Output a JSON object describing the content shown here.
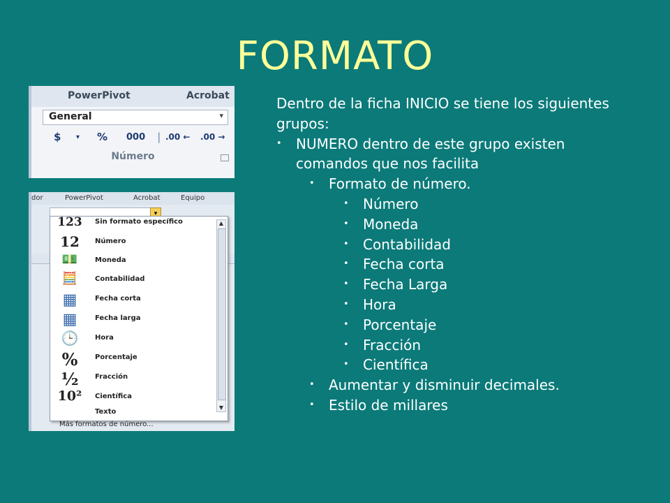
{
  "slide": {
    "title": "FORMATO",
    "intro": "Dentro de la ficha INICIO se tiene los siguientes grupos:",
    "level1": [
      {
        "text": "NUMERO dentro de este grupo existen comandos que nos facilita"
      }
    ],
    "level2_first": "Formato de número.",
    "level3": [
      "Número",
      "Moneda",
      "Contabilidad",
      "Fecha corta",
      "Fecha Larga",
      "Hora",
      "Porcentaje",
      "Fracción",
      "Científica"
    ],
    "level2_rest": [
      "Aumentar y disminuir decimales.",
      "Estilo de millares"
    ]
  },
  "ribbon_image": {
    "tabs": [
      "PowerPivot",
      "Acrobat"
    ],
    "combo_value": "General",
    "buttons": [
      "$",
      "%",
      "000",
      ".00 ←",
      ".00 →"
    ],
    "group_label": "Número"
  },
  "dropdown_image": {
    "tabs": [
      "dor",
      "PowerPivot",
      "Acrobat",
      "Equipo"
    ],
    "items": [
      {
        "icon": "123",
        "label": "Sin formato específico"
      },
      {
        "icon": "12",
        "label": "Número"
      },
      {
        "icon": "💵",
        "label": "Moneda"
      },
      {
        "icon": "🧮",
        "label": "Contabilidad"
      },
      {
        "icon": "▦",
        "label": "Fecha corta"
      },
      {
        "icon": "▦",
        "label": "Fecha larga"
      },
      {
        "icon": "🕒",
        "label": "Hora"
      },
      {
        "icon": "%",
        "label": "Porcentaje"
      },
      {
        "icon": "½",
        "label": "Fracción"
      },
      {
        "icon": "10²",
        "label": "Científica"
      },
      {
        "icon": "",
        "label": "Texto"
      }
    ],
    "more_link": "Más formatos de número..."
  },
  "colors": {
    "background": "#0b7a79",
    "title": "#ffff99",
    "text": "#ffffff"
  }
}
